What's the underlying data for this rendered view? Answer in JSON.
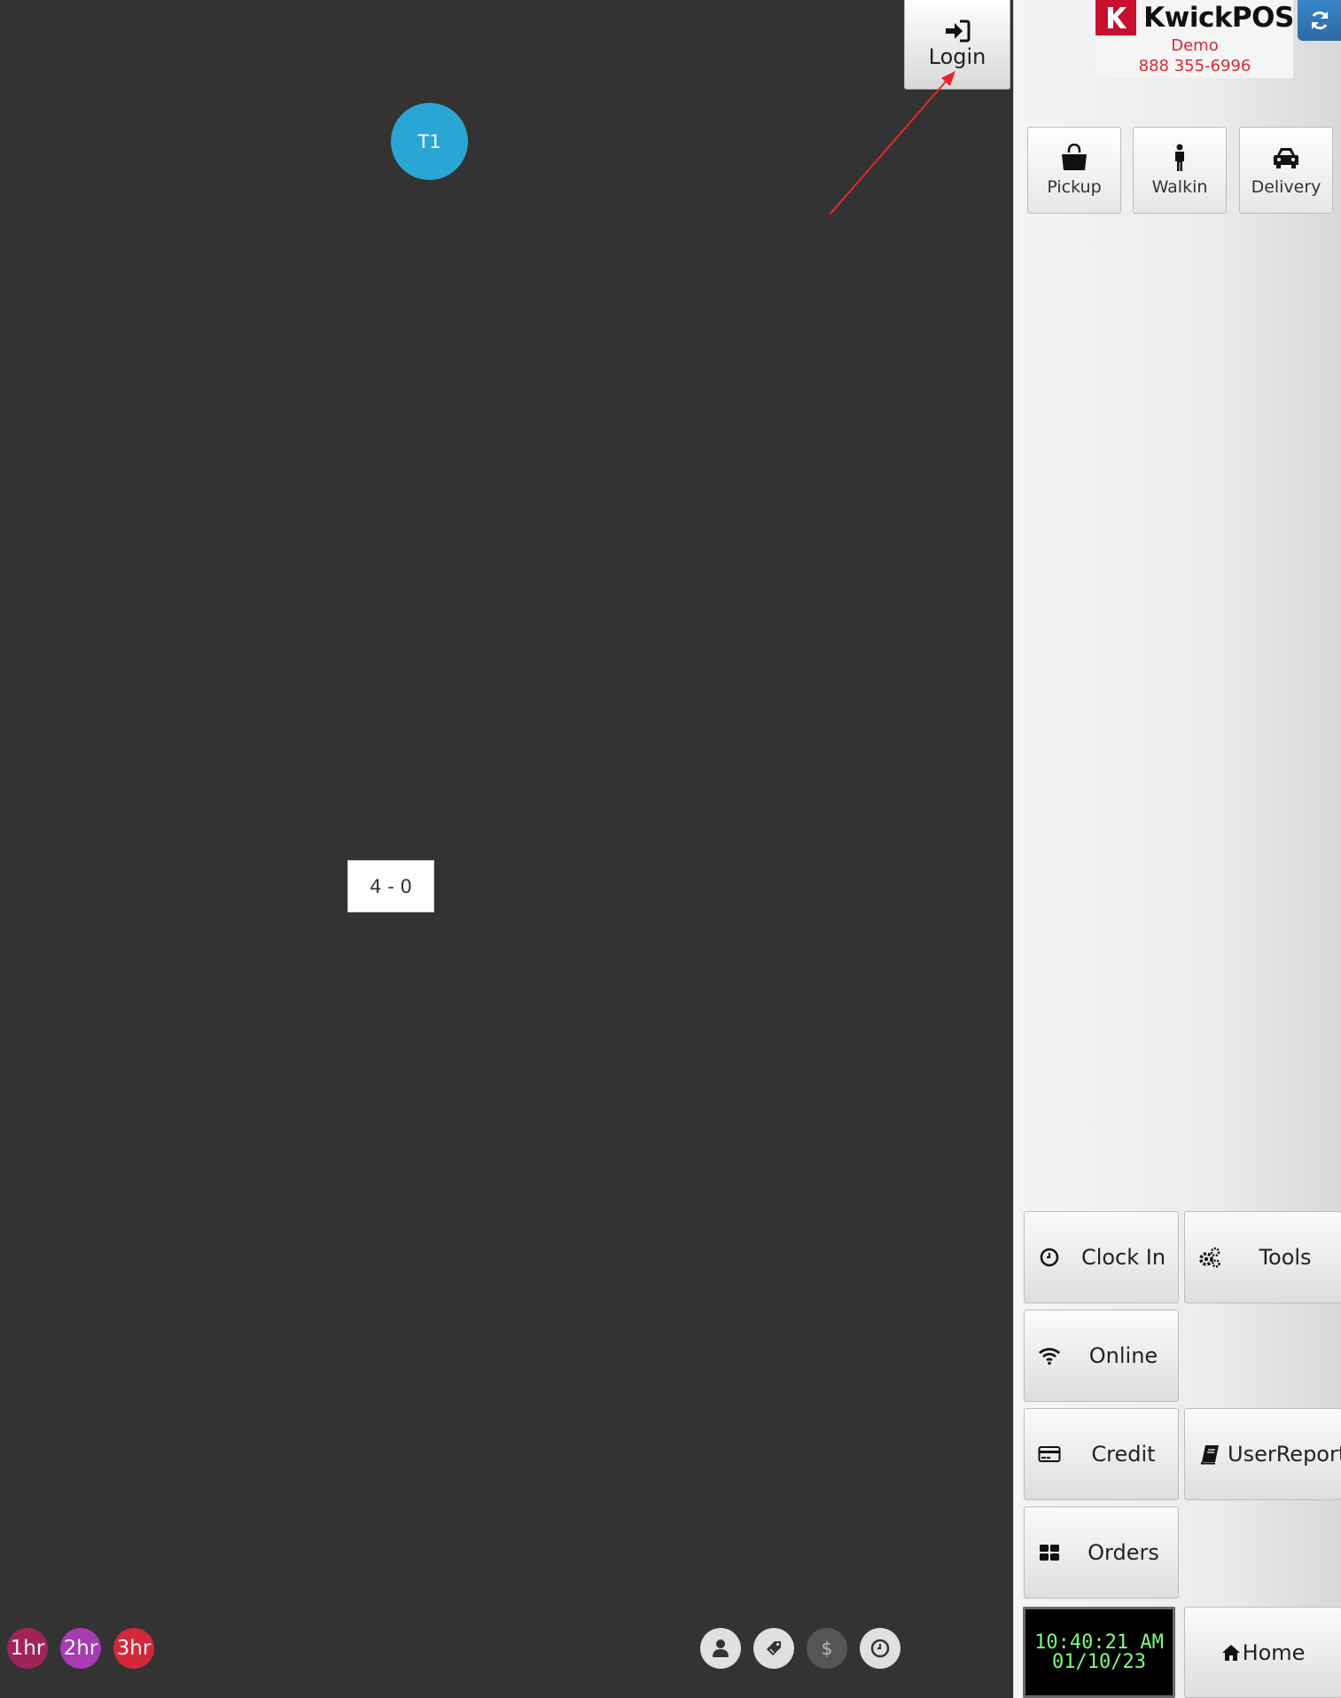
{
  "floor": {
    "login_label": "Login",
    "table_t1": {
      "label": "T1",
      "color": "#2aa6d4"
    },
    "section_label": "4 - 0",
    "timers": [
      {
        "label": "1hr",
        "color": "#a0245a"
      },
      {
        "label": "2hr",
        "color": "#a63bb2"
      },
      {
        "label": "3hr",
        "color": "#d1293a"
      }
    ],
    "filter_icons": [
      "user-icon",
      "tag-icon",
      "dollar-icon",
      "clock-icon"
    ]
  },
  "brand": {
    "name": "KwickPOS",
    "subtitle": "Demo",
    "phone": "888 355-6996",
    "accent_color": "#c8102e"
  },
  "order_types": [
    {
      "label": "Pickup",
      "icon": "shopping-bag-icon"
    },
    {
      "label": "Walkin",
      "icon": "person-icon"
    },
    {
      "label": "Delivery",
      "icon": "car-icon"
    }
  ],
  "panel_buttons": {
    "clock_in": "Clock In",
    "tools": "Tools",
    "online": "Online",
    "credit": "Credit",
    "user_report": "UserReport",
    "orders": "Orders",
    "home": "Home"
  },
  "clock": {
    "time": "10:40:21 AM",
    "date": "01/10/23"
  }
}
